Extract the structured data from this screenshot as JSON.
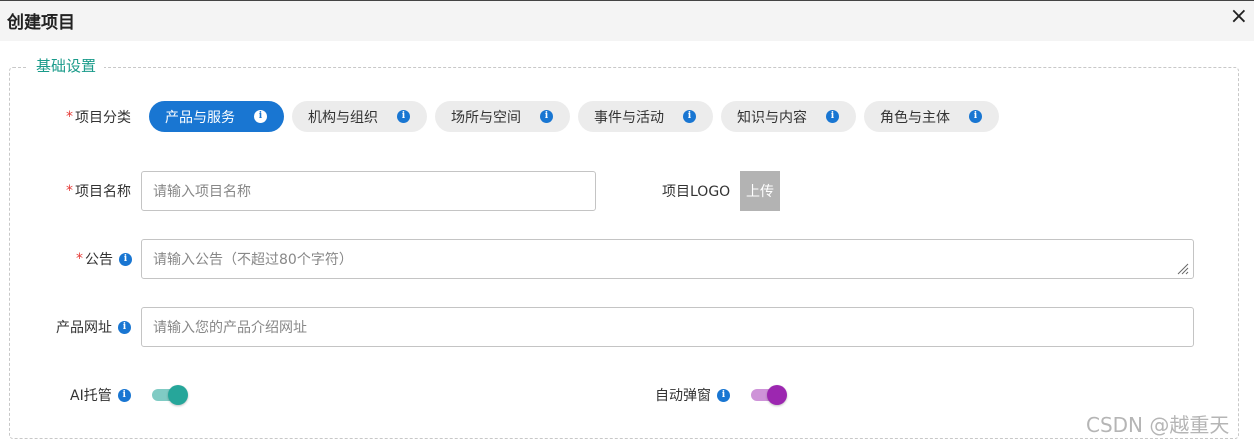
{
  "dialog": {
    "title": "创建项目",
    "close_label": "×"
  },
  "section": {
    "legend": "基础设置"
  },
  "required_mark": "*",
  "category": {
    "label": "项目分类",
    "options": [
      {
        "label": "产品与服务",
        "active": true
      },
      {
        "label": "机构与组织",
        "active": false
      },
      {
        "label": "场所与空间",
        "active": false
      },
      {
        "label": "事件与活动",
        "active": false
      },
      {
        "label": "知识与内容",
        "active": false
      },
      {
        "label": "角色与主体",
        "active": false
      }
    ]
  },
  "name_field": {
    "label": "项目名称",
    "placeholder": "请输入项目名称",
    "value": ""
  },
  "logo": {
    "label": "项目LOGO",
    "upload_label": "上传"
  },
  "notice_field": {
    "label": "公告",
    "placeholder": "请输入公告（不超过80个字符）",
    "value": ""
  },
  "url_field": {
    "label": "产品网址",
    "placeholder": "请输入您的产品介绍网址",
    "value": ""
  },
  "ai_hosting": {
    "label": "AI托管",
    "on": true
  },
  "auto_popup": {
    "label": "自动弹窗",
    "on": true
  },
  "icons": {
    "info": "info-icon",
    "close": "close-icon",
    "resize": "resize-handle-icon"
  },
  "colors": {
    "primary": "#1976d2",
    "legend": "#1a9b8a",
    "required": "#e53935",
    "toggle_teal_thumb": "#26a69a",
    "toggle_teal_track": "#80cbc4",
    "toggle_purple_thumb": "#9c27b0",
    "toggle_purple_track": "#ce93d8",
    "upload_bg": "#b3b3b3"
  },
  "watermark": "CSDN @越重天"
}
